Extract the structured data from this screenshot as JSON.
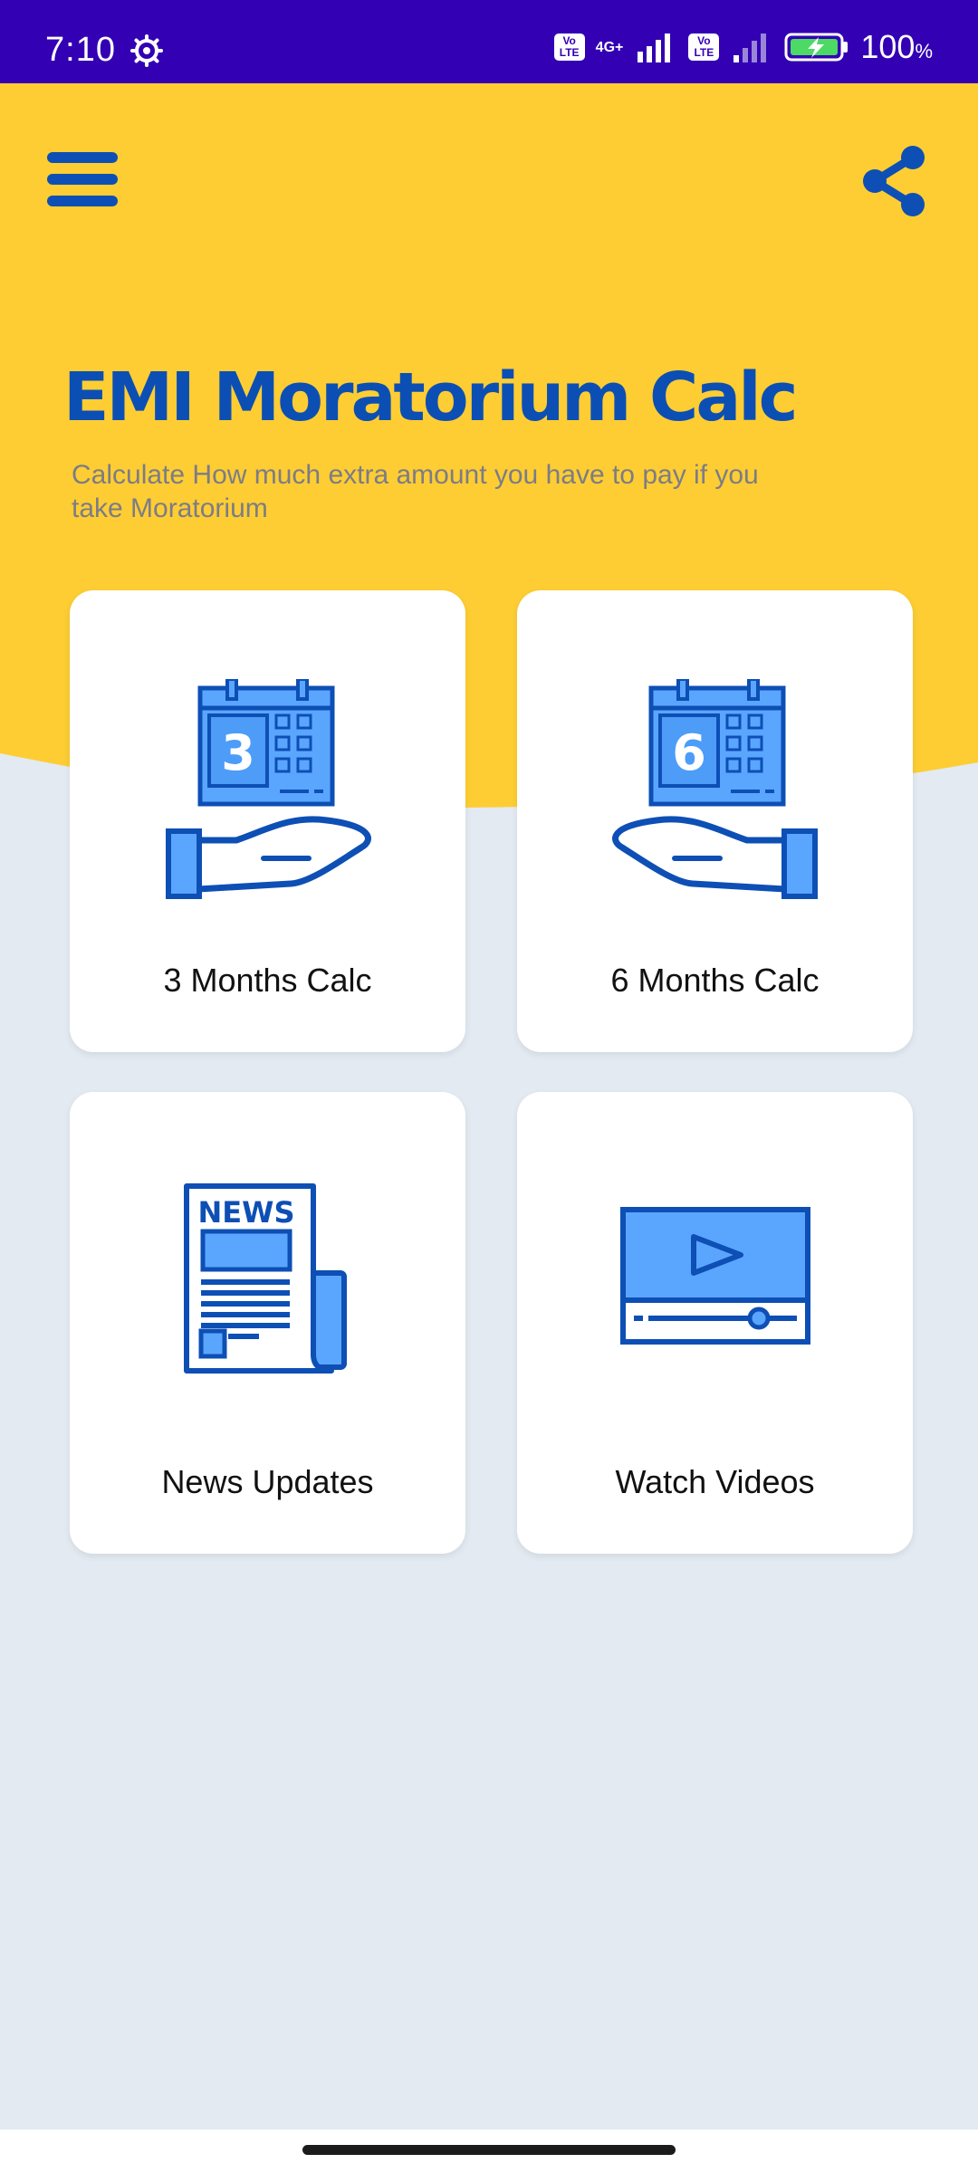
{
  "status_bar": {
    "time": "7:10",
    "net_type": "4G+",
    "volte_label": "Vo LTE",
    "battery": "100",
    "battery_unit": "%"
  },
  "header": {
    "title": "EMI Moratorium Calc",
    "subtitle": "Calculate How much extra amount you have to pay if you take Moratorium",
    "menu_icon": "hamburger-menu-icon",
    "share_icon": "share-icon"
  },
  "cards": [
    {
      "label": "3 Months Calc",
      "icon": "calendar-3-hand-icon",
      "number": "3"
    },
    {
      "label": "6 Months Calc",
      "icon": "calendar-6-hand-icon",
      "number": "6"
    },
    {
      "label": "News Updates",
      "icon": "newspaper-icon",
      "badge": "NEWS"
    },
    {
      "label": "Watch Videos",
      "icon": "video-player-icon"
    }
  ],
  "colors": {
    "status_bar": "#3300b4",
    "header_yellow": "#fdcd33",
    "accent_blue": "#0c4fb4",
    "icon_fill": "#5aa6ff",
    "background": "#e3eaf2"
  }
}
